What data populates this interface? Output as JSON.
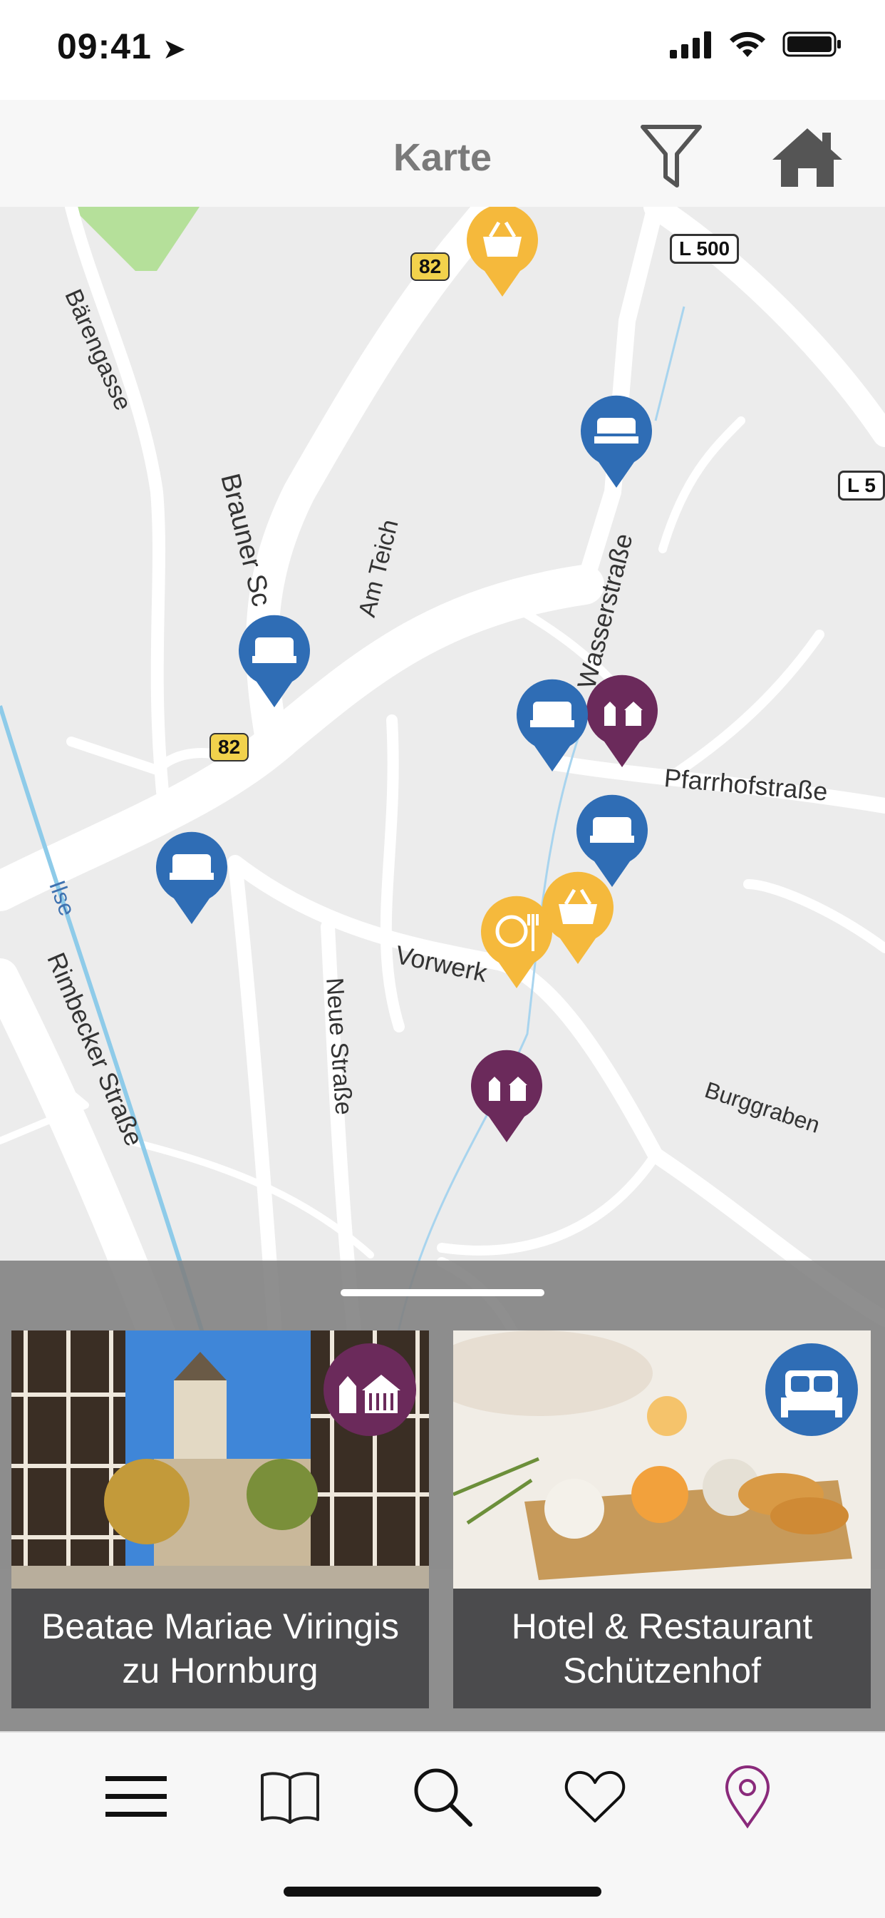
{
  "status_bar": {
    "time": "09:41"
  },
  "nav": {
    "title": "Karte"
  },
  "map": {
    "street_labels": {
      "baerengasse": "Bärengasse",
      "brauner": "Brauner Sc",
      "am_teich": "Am Teich",
      "wasserstrasse": "Wasserstraße",
      "pfarrhofstrasse": "Pfarrhofstraße",
      "vorwerk": "Vorwerk",
      "neue_strasse": "Neue Straße",
      "rimbecker": "Rimbecker Straße",
      "burggraben": "Burggraben",
      "ilse": "Ilse"
    },
    "road_badges": {
      "b82_top": "82",
      "b82_mid": "82",
      "l500": "L 500",
      "l5": "L 5"
    },
    "pin_categories": [
      "shopping",
      "hotel",
      "hotel",
      "hotel",
      "church",
      "hotel",
      "hotel",
      "shopping",
      "restaurant",
      "church"
    ],
    "colors": {
      "hotel": "#2f6db5",
      "church": "#6b2a5b",
      "shopping": "#f5b93c",
      "restaurant": "#f5b93c"
    }
  },
  "cards": [
    {
      "title_line1": "Beatae Mariae Viringis",
      "title_line2": "zu Hornburg",
      "category": "church-icon"
    },
    {
      "title_line1": "Hotel & Restaurant",
      "title_line2": "Schützenhof",
      "category": "bed-icon"
    }
  ],
  "tabs": [
    {
      "icon": "menu-icon",
      "active": false
    },
    {
      "icon": "book-icon",
      "active": false
    },
    {
      "icon": "search-icon",
      "active": false
    },
    {
      "icon": "heart-icon",
      "active": false
    },
    {
      "icon": "location-pin-icon",
      "active": true
    }
  ],
  "accent_color": "#8a2a7b"
}
